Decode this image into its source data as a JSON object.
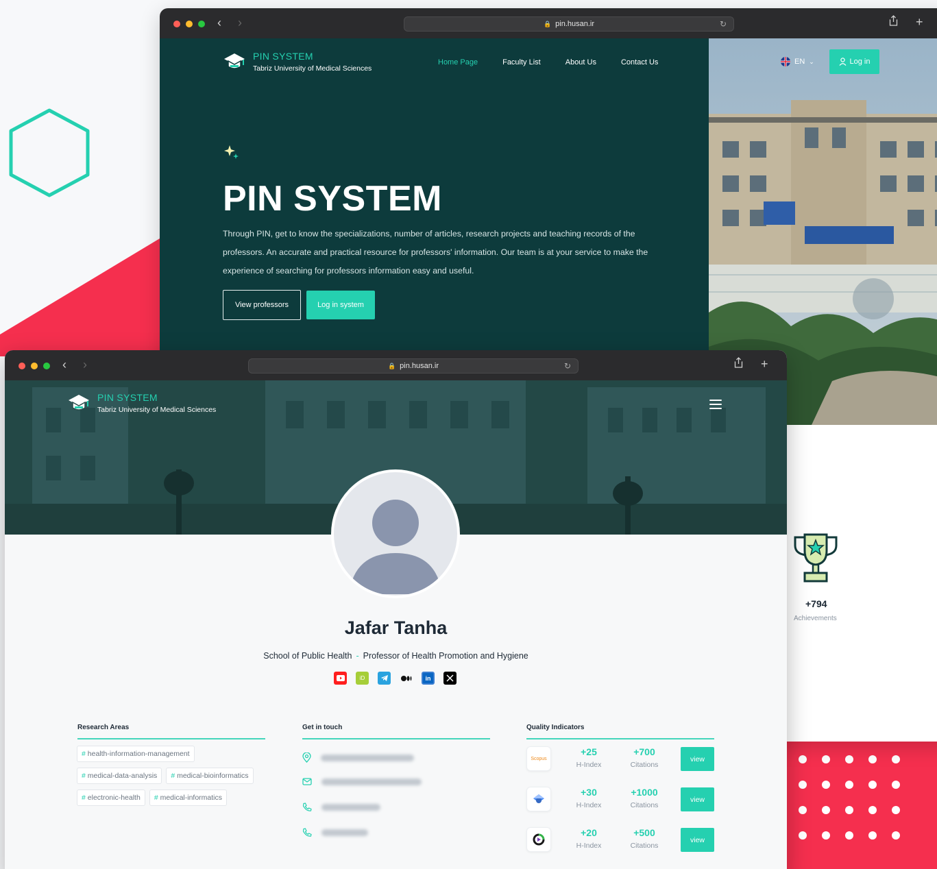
{
  "colors": {
    "accent": "#25d0b0",
    "dark_teal": "#0d3b3c",
    "brand_red": "#f52f4e"
  },
  "browser": {
    "back_url": "pin.husan.ir",
    "front_url": "pin.husan.ir"
  },
  "brand": {
    "title": "PIN SYSTEM",
    "subtitle": "Tabriz University of Medical Sciences"
  },
  "nav": {
    "items": [
      "Home Page",
      "Faculty List",
      "About Us",
      "Contact Us"
    ],
    "lang": "EN",
    "login": "Log in"
  },
  "hero": {
    "title": "PIN SYSTEM",
    "description": "Through PIN, get to know the specializations, number of articles, research projects and teaching records of the professors. An accurate and practical resource for professors' information. Our team is at your service to make the experience of searching for professors information easy and useful.",
    "btn_view": "View professors",
    "btn_login": "Log in system"
  },
  "achievements": {
    "value": "+794",
    "label": "Achievements"
  },
  "profile": {
    "name": "Jafar Tanha",
    "school": "School of Public Health",
    "separator": "-",
    "title": "Professor of Health Promotion and Hygiene",
    "socials": [
      "youtube-icon",
      "orcid-icon",
      "telegram-icon",
      "medium-icon",
      "linkedin-icon",
      "x-icon"
    ]
  },
  "research": {
    "heading": "Research Areas",
    "tags": [
      "health-information-management",
      "medical-data-analysis",
      "medical-bioinformatics",
      "electronic-health",
      "medical-informatics"
    ]
  },
  "contact": {
    "heading": "Get in touch",
    "icons": [
      "location-icon",
      "mail-icon",
      "phone-icon",
      "phone-icon"
    ]
  },
  "quality": {
    "heading": "Quality Indicators",
    "rows": [
      {
        "logo": "Scopus",
        "hindex": "+25",
        "hindex_label": "H-Index",
        "citations": "+700",
        "citations_label": "Citations",
        "btn": "view"
      },
      {
        "logo": "",
        "hindex": "+30",
        "hindex_label": "H-Index",
        "citations": "+1000",
        "citations_label": "Citations",
        "btn": "view"
      },
      {
        "logo": "",
        "hindex": "+20",
        "hindex_label": "H-Index",
        "citations": "+500",
        "citations_label": "Citations",
        "btn": "view"
      }
    ]
  }
}
